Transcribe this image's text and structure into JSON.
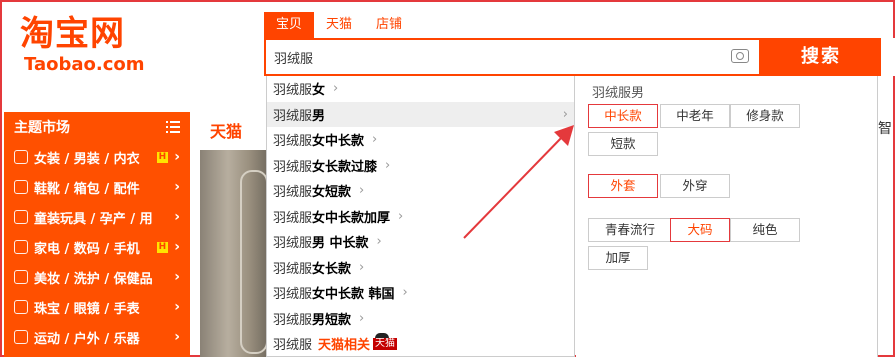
{
  "logo": {
    "cn": "淘宝网",
    "en": "Taobao.com"
  },
  "search": {
    "tabs": [
      {
        "label": "宝贝",
        "active": true
      },
      {
        "label": "天猫",
        "active": false
      },
      {
        "label": "店铺",
        "active": false
      }
    ],
    "query": "羽绒服",
    "button_label": "搜索"
  },
  "sidebar": {
    "title": "主题市场",
    "items": [
      {
        "label": "女装 / 男装 / 内衣",
        "badge": "H"
      },
      {
        "label": "鞋靴 / 箱包 / 配件",
        "badge": ""
      },
      {
        "label": "童装玩具 / 孕产 / 用",
        "badge": ""
      },
      {
        "label": "家电 / 数码 / 手机",
        "badge": "H"
      },
      {
        "label": "美妆 / 洗护 / 保健品",
        "badge": ""
      },
      {
        "label": "珠宝 / 眼镜 / 手表",
        "badge": ""
      },
      {
        "label": "运动 / 户外 / 乐器",
        "badge": ""
      }
    ]
  },
  "tmall_tab": "天猫",
  "suggestions": [
    {
      "prefix": "羽绒服",
      "suffix": "女"
    },
    {
      "prefix": "羽绒服",
      "suffix": "男"
    },
    {
      "prefix": "羽绒服",
      "suffix": "女中长款"
    },
    {
      "prefix": "羽绒服",
      "suffix": "女长款过膝"
    },
    {
      "prefix": "羽绒服",
      "suffix": "女短款"
    },
    {
      "prefix": "羽绒服",
      "suffix": "女中长款加厚"
    },
    {
      "prefix": "羽绒服",
      "suffix": "男 中长款"
    },
    {
      "prefix": "羽绒服",
      "suffix": "女长款"
    },
    {
      "prefix": "羽绒服",
      "suffix": "女中长款 韩国"
    },
    {
      "prefix": "羽绒服",
      "suffix": "男短款"
    },
    {
      "prefix": "羽绒服",
      "suffix": "",
      "tmall": "天猫相关",
      "badge": "天猫"
    }
  ],
  "attributes": {
    "title": "羽绒服男",
    "group1": [
      "中长款",
      "中老年",
      "修身款",
      "短款"
    ],
    "group2": [
      "外套",
      "外穿"
    ],
    "group3": [
      "青春流行",
      "大码",
      "纯色",
      "加厚"
    ]
  },
  "edge_text": "智",
  "colors": {
    "accent": "#ff4400",
    "highlight": "#e4393c",
    "arrow": "#e4393c"
  }
}
